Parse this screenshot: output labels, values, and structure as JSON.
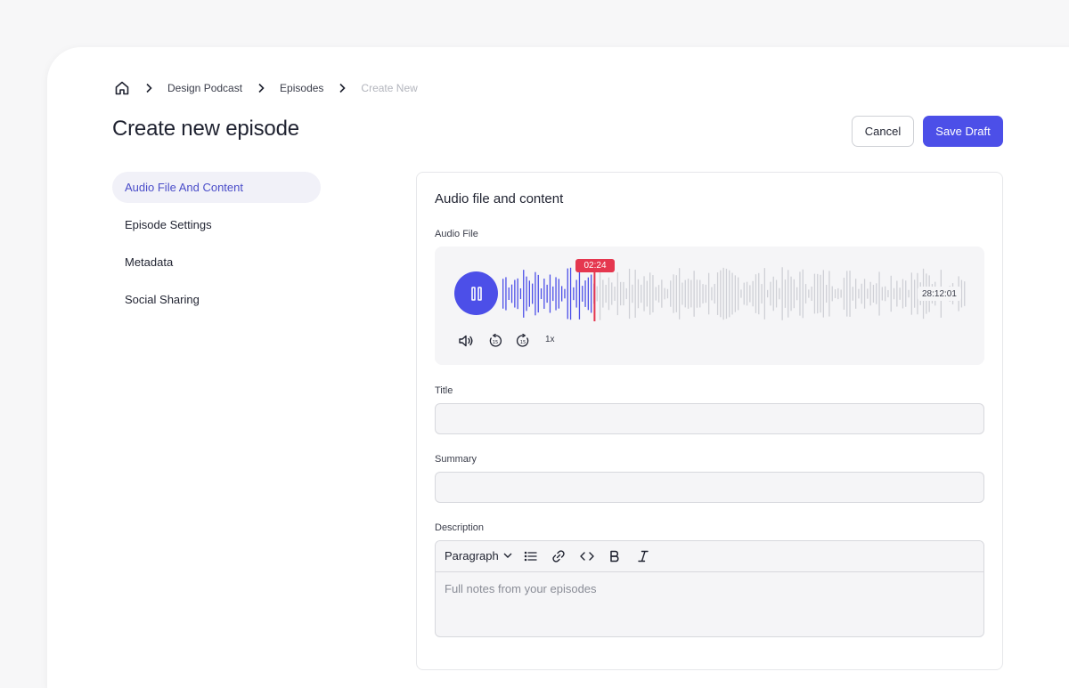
{
  "breadcrumb": {
    "items": [
      "Design Podcast",
      "Episodes"
    ],
    "current": "Create New"
  },
  "page": {
    "title": "Create new episode"
  },
  "actions": {
    "cancel": "Cancel",
    "save": "Save Draft"
  },
  "sidebar": {
    "items": [
      "Audio File And Content",
      "Episode Settings",
      "Metadata",
      "Social Sharing"
    ],
    "active_index": 0
  },
  "panel": {
    "title": "Audio file and content"
  },
  "audio": {
    "label": "Audio File",
    "current_time": "02:24",
    "duration": "28:12:01",
    "played_fraction": 0.2,
    "speed": "1x",
    "colors": {
      "played": "#4c4fe8",
      "unplayed": "#cfd0d6",
      "cursor": "#e5374f"
    }
  },
  "fields": {
    "title": {
      "label": "Title",
      "value": "",
      "placeholder": ""
    },
    "summary": {
      "label": "Summary",
      "value": "",
      "placeholder": ""
    },
    "description": {
      "label": "Description",
      "placeholder": "Full notes from your episodes",
      "format": "Paragraph"
    }
  },
  "toolbar_icons": [
    "list-icon",
    "link-icon",
    "code-icon",
    "bold-icon",
    "italic-icon"
  ],
  "colors": {
    "accent": "#4c4fe8",
    "active_bg": "#f1f1f8",
    "badge": "#e5374f"
  }
}
